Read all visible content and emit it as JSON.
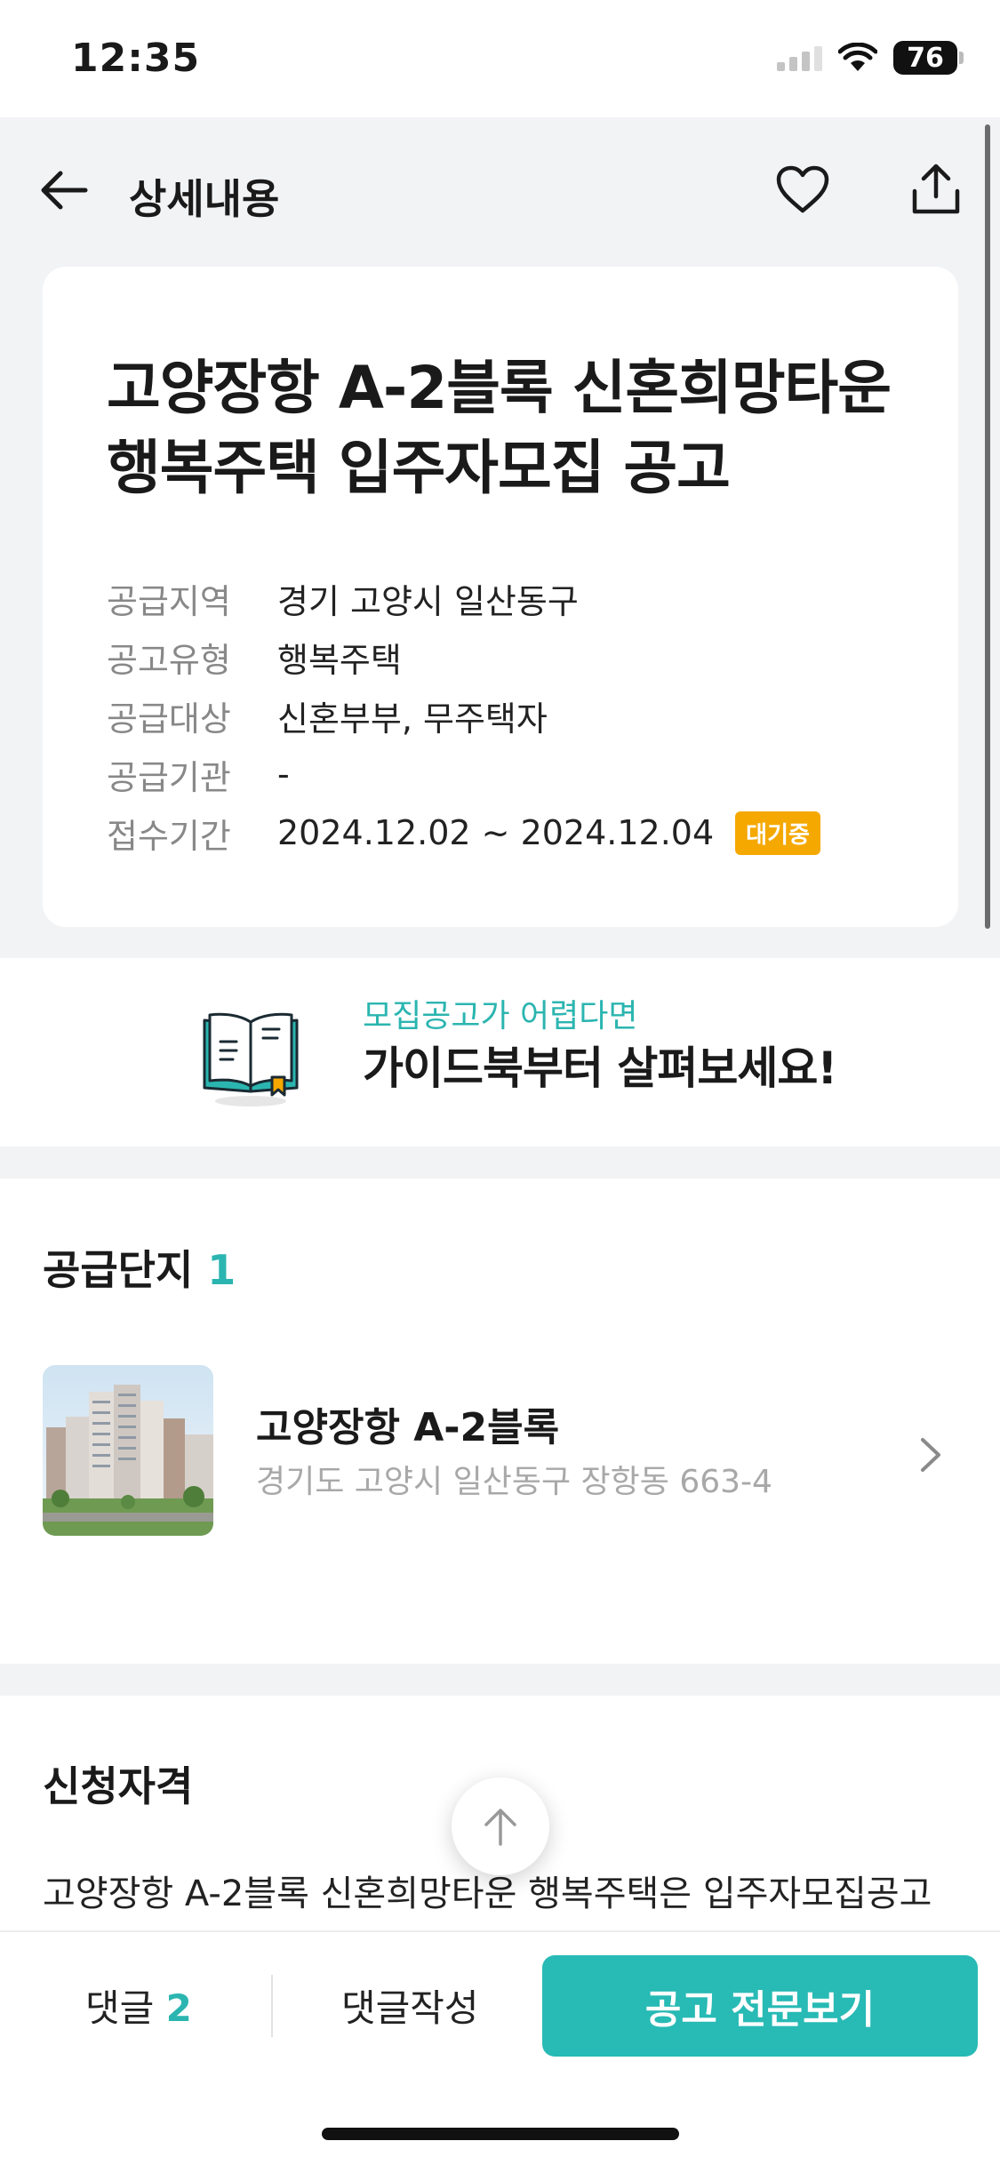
{
  "status_bar": {
    "time": "12:35",
    "battery": "76"
  },
  "header": {
    "title": "상세내용"
  },
  "notice": {
    "title": "고양장항 A-2블록 신혼희망타운 행복주택 입주자모집 공고",
    "rows": [
      {
        "label": "공급지역",
        "value": "경기 고양시 일산동구"
      },
      {
        "label": "공고유형",
        "value": "행복주택"
      },
      {
        "label": "공급대상",
        "value": "신혼부부, 무주택자"
      },
      {
        "label": "공급기관",
        "value": "-"
      },
      {
        "label": "접수기간",
        "value": "2024.12.02 ~ 2024.12.04"
      }
    ],
    "status_badge": "대기중"
  },
  "guide": {
    "subtitle": "모집공고가 어렵다면",
    "title": "가이드북부터 살펴보세요!"
  },
  "supply": {
    "section_title": "공급단지",
    "count": "1",
    "complex": {
      "name": "고양장항 A-2블록",
      "address": "경기도 고양시 일산동구 장항동 663-4"
    }
  },
  "qualification": {
    "section_title": "신청자격",
    "text": "고양장항 A-2블록 신혼희망타운 행복주택은 입주자모집공고"
  },
  "bottom_bar": {
    "comment_label": "댓글",
    "comment_count": "2",
    "write_label": "댓글작성",
    "full_notice_label": "공고 전문보기"
  },
  "colors": {
    "accent": "#2bb5b0",
    "badge": "#f5a800",
    "button": "#28bab5"
  }
}
